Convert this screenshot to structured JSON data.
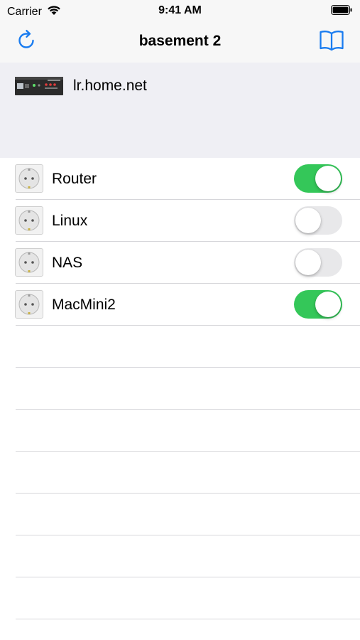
{
  "status_bar": {
    "carrier": "Carrier",
    "time": "9:41 AM",
    "icons": [
      "wifi-icon",
      "battery-icon"
    ]
  },
  "nav": {
    "title": "basement 2",
    "left_icon": "refresh-icon",
    "right_icon": "book-icon",
    "accent": "#1a7cf0"
  },
  "device": {
    "hostname": "lr.home.net"
  },
  "outlets": [
    {
      "label": "Router",
      "on": true
    },
    {
      "label": "Linux",
      "on": false
    },
    {
      "label": "NAS",
      "on": false
    },
    {
      "label": "MacMini2",
      "on": true
    }
  ],
  "colors": {
    "toggle_on": "#34c759",
    "toggle_off": "#e8e8ea",
    "header_bg": "#efeff4"
  }
}
